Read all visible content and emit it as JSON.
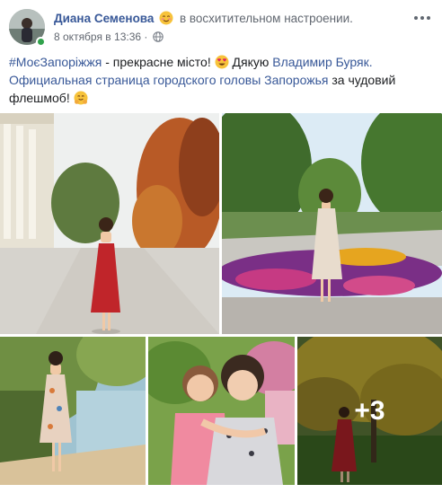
{
  "post": {
    "author_name": "Диана Семенова",
    "feeling_text": "в восхитительном настроении.",
    "feeling_icon": "smiling-blush-emoji-icon",
    "timestamp": "8 октября в 13:36",
    "meta_separator": " · ",
    "privacy_icon": "globe-icon",
    "more_icon": "more-options-icon"
  },
  "text": {
    "hashtag": "#МоєЗапоріжжя",
    "part1": " - прекрасне місто! ",
    "heart_eyes_icon": "heart-eyes-emoji-icon",
    "part2": " Дякую ",
    "mention1": "Владимир Буряк.",
    "mention2": "Официальная страница городскогo головы Запорожья",
    "part3": " за чудовий флешмоб! ",
    "end_icon": "hugging-emoji-icon"
  },
  "photos": {
    "items": [
      {
        "name": "photo-woman-red-dress-boulevard"
      },
      {
        "name": "photo-woman-flower-bed"
      },
      {
        "name": "photo-woman-riverside"
      },
      {
        "name": "photo-mother-daughter-selfie"
      },
      {
        "name": "photo-woman-red-dress-yellow-tree"
      }
    ],
    "more_count_label": "+3"
  },
  "colors": {
    "link": "#385898",
    "text": "#1c1e21",
    "secondary": "#616770",
    "online": "#31a24c"
  }
}
